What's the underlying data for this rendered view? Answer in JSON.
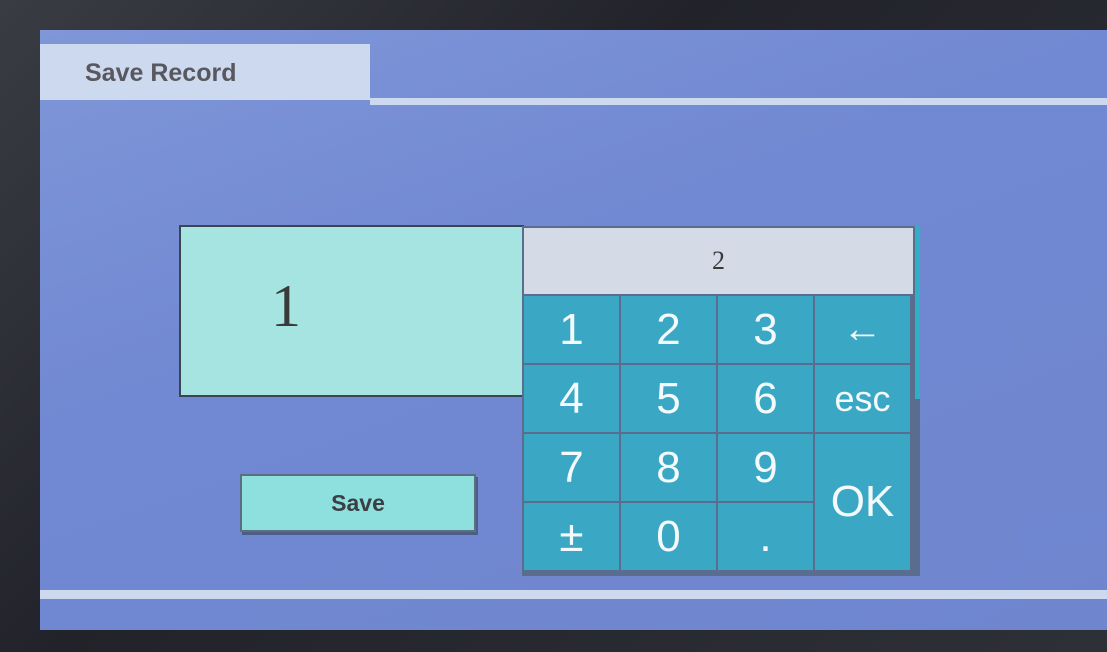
{
  "header": {
    "title": "Save Record"
  },
  "field": {
    "value": "1"
  },
  "keypad": {
    "display": "2",
    "keys": {
      "k1": "1",
      "k2": "2",
      "k3": "3",
      "back": "←",
      "k4": "4",
      "k5": "5",
      "k6": "6",
      "esc": "esc",
      "k7": "7",
      "k8": "8",
      "k9": "9",
      "ok": "OK",
      "sign": "±",
      "k0": "0",
      "dot": "."
    }
  },
  "actions": {
    "save_label": "Save"
  },
  "colors": {
    "screen": "#7189d2",
    "panel_light": "#cdd9ef",
    "field": "#a6e4e2",
    "key": "#3aa8c5"
  }
}
